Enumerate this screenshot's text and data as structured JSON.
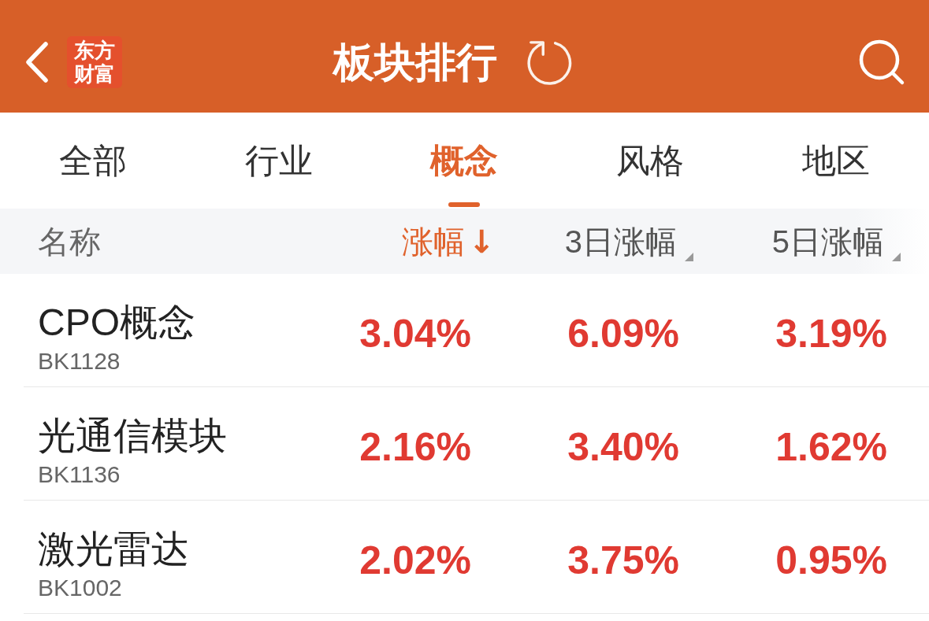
{
  "header": {
    "logo_lines": [
      "东方",
      "财富"
    ],
    "title": "板块排行"
  },
  "tabs": [
    {
      "label": "全部",
      "selected": false
    },
    {
      "label": "行业",
      "selected": false
    },
    {
      "label": "概念",
      "selected": true
    },
    {
      "label": "风格",
      "selected": false
    },
    {
      "label": "地区",
      "selected": false
    }
  ],
  "columns": [
    {
      "label": "名称",
      "kind": "name"
    },
    {
      "label": "涨幅",
      "kind": "sort",
      "selected": true,
      "arrow": "↓"
    },
    {
      "label": "3日涨幅",
      "kind": "sort",
      "selected": false
    },
    {
      "label": "5日涨幅",
      "kind": "sort",
      "selected": false
    }
  ],
  "rows": [
    {
      "name": "CPO概念",
      "code": "BK1128",
      "rising": true,
      "values": [
        "3.04%",
        "6.09%",
        "3.19%"
      ]
    },
    {
      "name": "光通信模块",
      "code": "BK1136",
      "rising": true,
      "values": [
        "2.16%",
        "3.40%",
        "1.62%"
      ]
    },
    {
      "name": "激光雷达",
      "code": "BK1002",
      "rising": true,
      "values": [
        "2.02%",
        "3.75%",
        "0.95%"
      ]
    }
  ]
}
